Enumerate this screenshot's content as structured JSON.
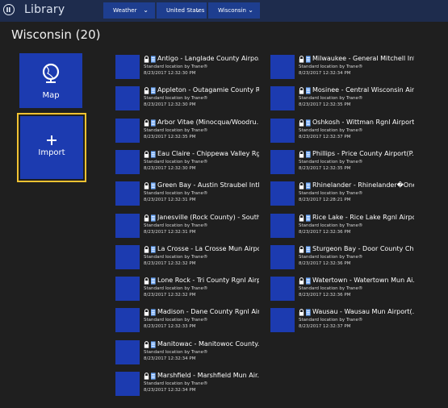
{
  "app": {
    "title": "Library"
  },
  "breadcrumbs": [
    {
      "label": "Weather"
    },
    {
      "label": "United States"
    },
    {
      "label": "Wisconsin"
    }
  ],
  "page": {
    "title": "Wisconsin (20)"
  },
  "tiles": {
    "map": {
      "label": "Map",
      "icon": "globe-icon"
    },
    "import": {
      "label": "Import",
      "icon": "plus-icon"
    }
  },
  "colors": {
    "tile": "#1c3bb0",
    "highlight": "#f1c232",
    "topbar": "#1e2c4d",
    "crumb": "#1e3e8f",
    "background": "#1f1f1f"
  },
  "locations_left": [
    {
      "name": "Antigo - Langlade County Airpo...",
      "sub": "Standard location by Trane®",
      "date": "8/23/2017 12:32:30 PM"
    },
    {
      "name": "Appleton - Outagamie County R...",
      "sub": "Standard location by Trane®",
      "date": "8/23/2017 12:32:30 PM"
    },
    {
      "name": "Arbor Vitae (Minocqua/Woodru...",
      "sub": "Standard location by Trane®",
      "date": "8/23/2017 12:32:35 PM"
    },
    {
      "name": "Eau Claire - Chippewa Valley Rg...",
      "sub": "Standard location by Trane®",
      "date": "8/23/2017 12:32:30 PM"
    },
    {
      "name": "Green Bay - Austin Straubel Intl...",
      "sub": "Standard location by Trane®",
      "date": "8/23/2017 12:32:31 PM"
    },
    {
      "name": "Janesville (Rock County) - South...",
      "sub": "Standard location by Trane®",
      "date": "8/23/2017 12:32:31 PM"
    },
    {
      "name": "La Crosse - La Crosse Mun Airpo...",
      "sub": "Standard location by Trane®",
      "date": "8/23/2017 12:32:32 PM"
    },
    {
      "name": "Lone Rock - Tri County Rgnl Airp...",
      "sub": "Standard location by Trane®",
      "date": "8/23/2017 12:32:32 PM"
    },
    {
      "name": "Madison - Dane County Rgnl Air...",
      "sub": "Standard location by Trane®",
      "date": "8/23/2017 12:32:33 PM"
    },
    {
      "name": "Manitowac - Manitowoc County...",
      "sub": "Standard location by Trane®",
      "date": "8/23/2017 12:32:34 PM"
    },
    {
      "name": "Marshfield - Marshfield Mun Air...",
      "sub": "Standard location by Trane®",
      "date": "8/23/2017 12:32:34 PM"
    }
  ],
  "locations_right": [
    {
      "name": "Milwaukee - General Mitchell Int...",
      "sub": "Standard location by Trane®",
      "date": "8/23/2017 12:32:34 PM"
    },
    {
      "name": "Mosinee - Central Wisconsin Air...",
      "sub": "Standard location by Trane®",
      "date": "8/23/2017 12:32:35 PM"
    },
    {
      "name": "Oshkosh - Wittman Rgnl Airport...",
      "sub": "Standard location by Trane®",
      "date": "8/23/2017 12:32:37 PM"
    },
    {
      "name": "Phillips - Price County Airport(P...",
      "sub": "Standard location by Trane®",
      "date": "8/23/2017 12:32:35 PM"
    },
    {
      "name": "Rhinelander - Rhinelander�One...",
      "sub": "Standard location by Trane®",
      "date": "8/23/2017 12:28:21 PM"
    },
    {
      "name": "Rice Lake - Rice Lake Rgnl Airpor...",
      "sub": "Standard location by Trane®",
      "date": "8/23/2017 12:32:36 PM"
    },
    {
      "name": "Sturgeon Bay - Door County Ch...",
      "sub": "Standard location by Trane®",
      "date": "8/23/2017 12:32:36 PM"
    },
    {
      "name": "Watertown - Watertown Mun Ai...",
      "sub": "Standard location by Trane®",
      "date": "8/23/2017 12:32:36 PM"
    },
    {
      "name": "Wausau - Wausau Mun Airport(...",
      "sub": "Standard location by Trane®",
      "date": "8/23/2017 12:32:37 PM"
    }
  ]
}
